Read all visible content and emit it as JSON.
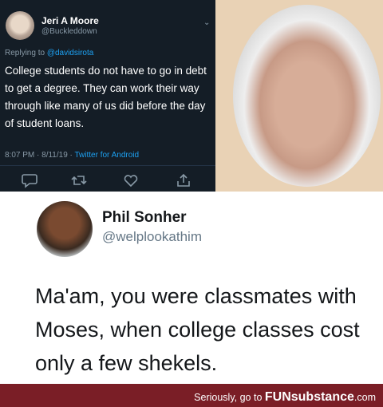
{
  "dark_tweet": {
    "name": "Jeri A Moore",
    "handle": "@Buckleddown",
    "reply_prefix": "Replying to ",
    "reply_mention": "@davidsirota",
    "text": "College students do not have to go in debt to get a degree. They can work their way through like many of us did before the day of student loans.",
    "time": "8:07 PM · 8/11/19 · ",
    "source": "Twitter for Android",
    "actions": [
      "reply-icon",
      "retweet-icon",
      "like-icon",
      "share-icon"
    ]
  },
  "light_tweet": {
    "name": "Phil Sonher",
    "handle": "@welplookathim",
    "text": "Ma'am, you were classmates with Moses, when college classes cost only a few shekels."
  },
  "footer": {
    "prefix": "Seriously, go to ",
    "brand": "FUNsubstance",
    "suffix": ".com"
  },
  "colors": {
    "dark_bg": "#141d26",
    "link": "#1da1f2",
    "muted": "#8899a6",
    "footer_bg": "#7a1e26"
  }
}
